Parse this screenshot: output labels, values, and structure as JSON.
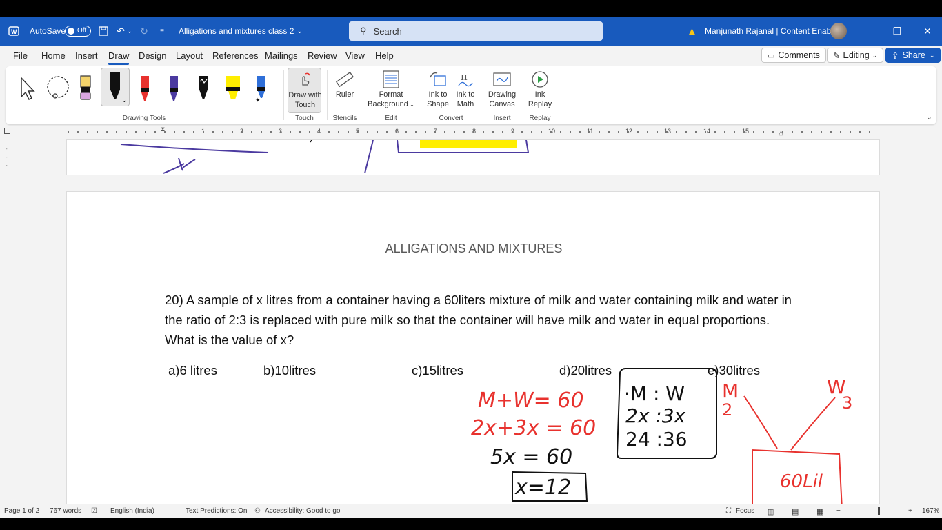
{
  "titlebar": {
    "autosave_label": "AutoSave",
    "autosave_state": "Off",
    "doc_title": "Alligations and mixtures class 2",
    "search_placeholder": "Search",
    "user_name": "Manjunath Rajanal | Content Enablers"
  },
  "menu": {
    "tabs": [
      "File",
      "Home",
      "Insert",
      "Draw",
      "Design",
      "Layout",
      "References",
      "Mailings",
      "Review",
      "View",
      "Help"
    ],
    "active_tab": "Draw",
    "comments": "Comments",
    "editing": "Editing",
    "share": "Share"
  },
  "ribbon": {
    "groups": {
      "drawing_tools": "Drawing Tools",
      "touch": "Touch",
      "stencils": "Stencils",
      "edit": "Edit",
      "convert": "Convert",
      "insert": "Insert",
      "replay": "Replay"
    },
    "draw_with_touch_1": "Draw with",
    "draw_with_touch_2": "Touch",
    "ruler": "Ruler",
    "format_background_1": "Format",
    "format_background_2": "Background",
    "ink_to_shape_1": "Ink to",
    "ink_to_shape_2": "Shape",
    "ink_to_math_1": "Ink to",
    "ink_to_math_2": "Math",
    "drawing_canvas_1": "Drawing",
    "drawing_canvas_2": "Canvas",
    "ink_replay_1": "Ink",
    "ink_replay_2": "Replay"
  },
  "ruler_numbers": [
    "1",
    "2",
    "3",
    "4",
    "5",
    "6",
    "7",
    "8",
    "9",
    "10",
    "11",
    "12",
    "13",
    "14",
    "15"
  ],
  "document": {
    "heading": "ALLIGATIONS AND MIXTURES",
    "question": "20) A sample of x litres from a container having a 60liters mixture of milk and water containing milk and water in the ratio of 2:3 is replaced with pure milk so that the container will have milk and water in equal proportions. What is the value of x?",
    "options": [
      "a)6 litres",
      "b)10litres",
      "c)15litres",
      "d)20litres",
      "e)30litres"
    ]
  },
  "status": {
    "page": "Page 1 of 2",
    "words": "767 words",
    "language": "English (India)",
    "text_predictions": "Text Predictions: On",
    "accessibility": "Accessibility: Good to go",
    "focus": "Focus",
    "zoom": "167%"
  },
  "colors": {
    "brand": "#185abd",
    "ink_red": "#e8322e",
    "ink_black": "#111111",
    "ink_purple": "#4b3aa0",
    "highlight_yellow": "#ffee00"
  }
}
